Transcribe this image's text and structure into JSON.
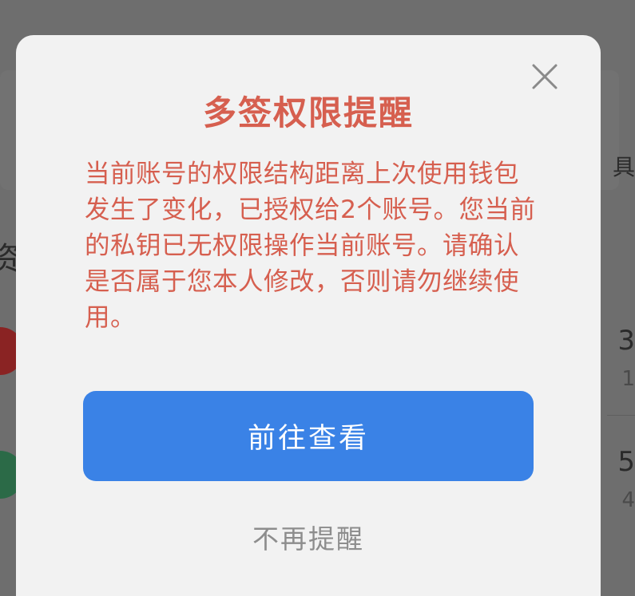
{
  "dialog": {
    "title": "多签权限提醒",
    "message": "当前账号的权限结构距离上次使用钱包发生了变化，已授权给2个账号。您当前的私钥已无权限操作当前账号。请确认是否属于您本人修改，否则请勿继续使用。",
    "primary_label": "前往查看",
    "dismiss_label": "不再提醒",
    "close_icon": "close-icon"
  },
  "background": {
    "left_partial_glyph": "资",
    "right_partial_text_1": "具",
    "right_value_1": "3",
    "right_sub_1": "1",
    "right_value_2": "5",
    "right_sub_2": "4"
  },
  "colors": {
    "title": "#d65f4f",
    "message": "#d65f4f",
    "primary_button": "#3a82e6",
    "dismiss_text": "#8d8d8d",
    "dialog_background": "#f2f2f2"
  }
}
